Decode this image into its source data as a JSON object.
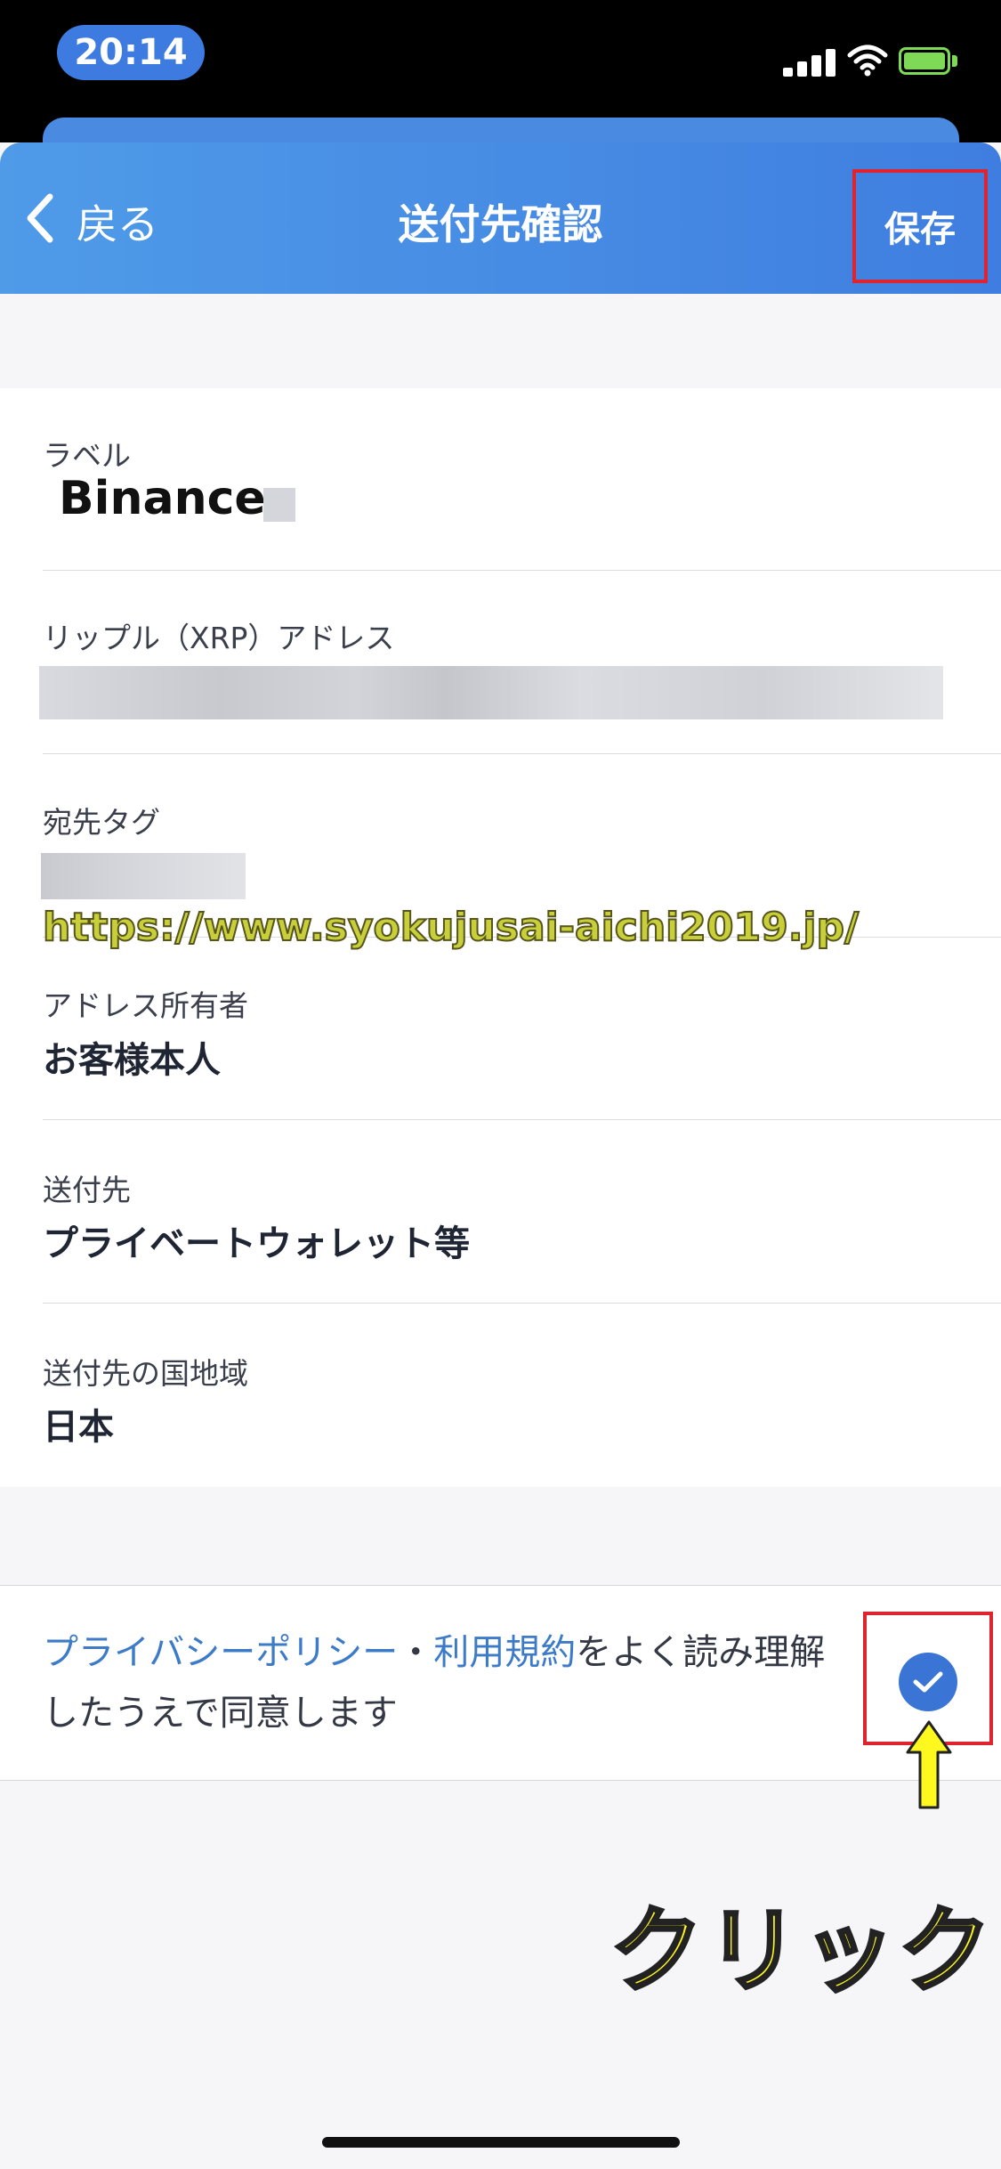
{
  "status_bar": {
    "time": "20:14"
  },
  "header": {
    "back_label": "戻る",
    "title": "送付先確認",
    "save_label": "保存"
  },
  "fields": {
    "label": {
      "title": "ラベル",
      "value": "Binance"
    },
    "address": {
      "title": "リップル（XRP）アドレス"
    },
    "tag": {
      "title": "宛先タグ"
    },
    "owner": {
      "title": "アドレス所有者",
      "value": "お客様本人"
    },
    "destination": {
      "title": "送付先",
      "value": "プライベートウォレット等"
    },
    "country": {
      "title": "送付先の国地域",
      "value": "日本"
    }
  },
  "consent": {
    "privacy_link": "プライバシーポリシー",
    "separator": "・",
    "terms_link": "利用規約",
    "text_rest": "をよく読み理解したうえで同意します",
    "checked": true
  },
  "annotations": {
    "click_label": "クリック",
    "watermark_url": "https://www.syokujusai-aichi2019.jp/",
    "highlight_color": "#e0242f",
    "arrow_color": "#fff81f"
  }
}
